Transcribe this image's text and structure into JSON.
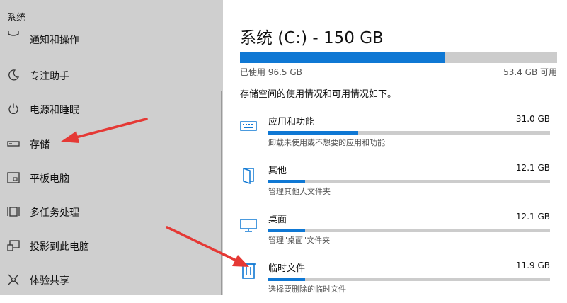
{
  "sidebar": {
    "title": "系统",
    "items": [
      {
        "label": "通知和操作",
        "icon": "notification-icon"
      },
      {
        "label": "专注助手",
        "icon": "moon-icon"
      },
      {
        "label": "电源和睡眠",
        "icon": "power-icon"
      },
      {
        "label": "存储",
        "icon": "storage-icon"
      },
      {
        "label": "平板电脑",
        "icon": "tablet-icon"
      },
      {
        "label": "多任务处理",
        "icon": "multitasking-icon"
      },
      {
        "label": "投影到此电脑",
        "icon": "project-icon"
      },
      {
        "label": "体验共享",
        "icon": "share-icon"
      }
    ]
  },
  "main": {
    "drive_title": "系统 (C:) - 150 GB",
    "usage_fraction": 0.644,
    "used_text": "已使用 96.5 GB",
    "free_text": "53.4 GB 可用",
    "description": "存储空间的使用情况和可用情况如下。",
    "categories": [
      {
        "name": "应用和功能",
        "size": "31.0 GB",
        "subtitle": "卸载未使用或不想要的应用和功能",
        "fraction": 0.32,
        "icon": "apps-keyboard-icon"
      },
      {
        "name": "其他",
        "size": "12.1 GB",
        "subtitle": "管理其他大文件夹",
        "fraction": 0.13,
        "icon": "folder-icon"
      },
      {
        "name": "桌面",
        "size": "12.1 GB",
        "subtitle": "管理\"桌面\"文件夹",
        "fraction": 0.13,
        "icon": "monitor-icon"
      },
      {
        "name": "临时文件",
        "size": "11.9 GB",
        "subtitle": "选择要删除的临时文件",
        "fraction": 0.13,
        "icon": "trash-icon"
      }
    ]
  },
  "colors": {
    "accent": "#0f78d4",
    "sidebar_bg": "#cfcfcf",
    "bar_track": "#cccccc",
    "annotation_arrow": "#e53935"
  }
}
